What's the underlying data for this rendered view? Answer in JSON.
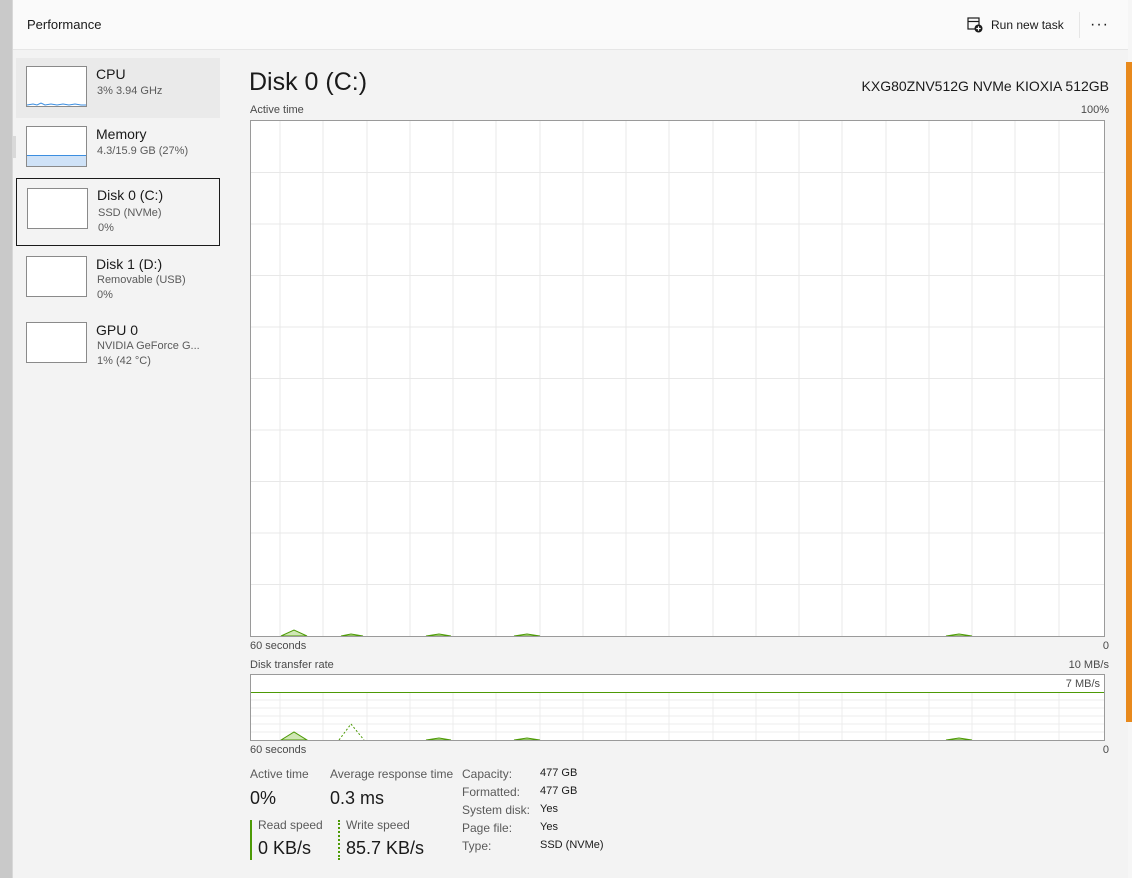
{
  "header": {
    "title": "Performance",
    "run_new_task": "Run new task",
    "more": "···"
  },
  "sidebar": {
    "items": [
      {
        "name": "CPU",
        "line1": "3% 3.94 GHz",
        "line2": ""
      },
      {
        "name": "Memory",
        "line1": "4.3/15.9 GB (27%)",
        "line2": ""
      },
      {
        "name": "Disk 0 (C:)",
        "line1": "SSD (NVMe)",
        "line2": "0%"
      },
      {
        "name": "Disk 1 (D:)",
        "line1": "Removable (USB)",
        "line2": "0%"
      },
      {
        "name": "GPU 0",
        "line1": "NVIDIA GeForce G...",
        "line2": "1% (42 °C)"
      }
    ]
  },
  "main": {
    "title": "Disk 0 (C:)",
    "model": "KXG80ZNV512G NVMe KIOXIA 512GB",
    "active_chart": {
      "label": "Active time",
      "max_label": "100%",
      "time_label": "60 seconds",
      "min_label": "0"
    },
    "transfer_chart": {
      "label": "Disk transfer rate",
      "max_label": "10 MB/s",
      "ref_label": "7 MB/s",
      "time_label": "60 seconds",
      "min_label": "0"
    },
    "stats": {
      "active_time_label": "Active time",
      "active_time_value": "0%",
      "avg_response_label": "Average response time",
      "avg_response_value": "0.3 ms",
      "read_label": "Read speed",
      "read_value": "0 KB/s",
      "write_label": "Write speed",
      "write_value": "85.7 KB/s"
    },
    "properties": [
      {
        "label": "Capacity:",
        "value": "477 GB"
      },
      {
        "label": "Formatted:",
        "value": "477 GB"
      },
      {
        "label": "System disk:",
        "value": "Yes"
      },
      {
        "label": "Page file:",
        "value": "Yes"
      },
      {
        "label": "Type:",
        "value": "SSD (NVMe)"
      }
    ]
  },
  "colors": {
    "disk_green": "#4d9a06",
    "memory_blue": "#3c8ee0",
    "grid": "#e8e8e8",
    "accent_orange": "#e8891c"
  }
}
